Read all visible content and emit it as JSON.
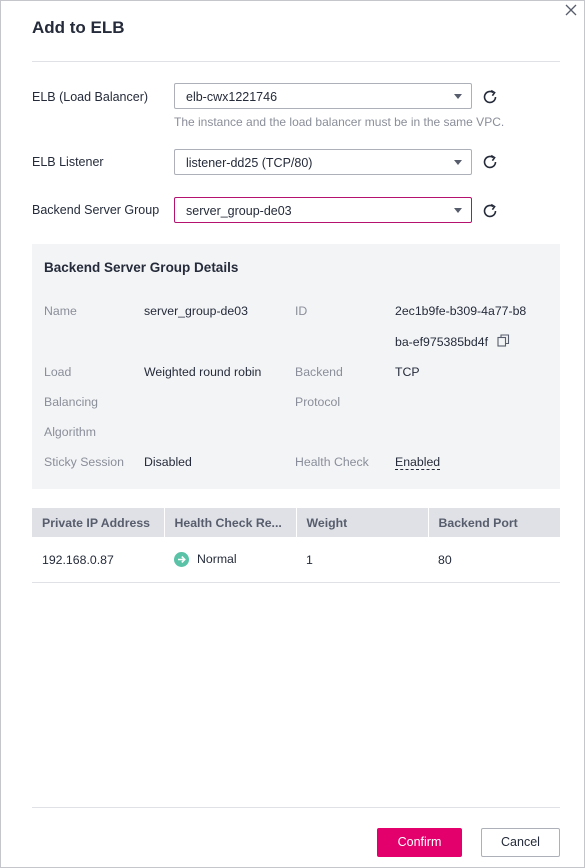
{
  "dialog": {
    "title": "Add to ELB",
    "close_icon": "close-icon"
  },
  "form": {
    "elb_label": "ELB (Load Balancer)",
    "elb_value": "elb-cwx1221746",
    "elb_hint": "The instance and the load balancer must be in the same VPC.",
    "listener_label": "ELB Listener",
    "listener_value": "listener-dd25 (TCP/80)",
    "group_label": "Backend Server Group",
    "group_value": "server_group-de03",
    "refresh_icon": "refresh-icon",
    "dropdown_icon": "chevron-down-icon"
  },
  "details": {
    "title": "Backend Server Group Details",
    "name_label": "Name",
    "name_value": "server_group-de03",
    "id_label": "ID",
    "id_value_line1": "2ec1b9fe-b309-4a77-b8",
    "id_value_line2": "ba-ef975385bd4f",
    "copy_icon": "copy-icon",
    "lb_label_line1": "Load",
    "lb_label_line2": "Balancing",
    "lb_label_line3": "Algorithm",
    "lb_value": "Weighted round robin",
    "proto_label_line1": "Backend",
    "proto_label_line2": "Protocol",
    "proto_value": "TCP",
    "sticky_label": "Sticky Session",
    "sticky_value": "Disabled",
    "health_label": "Health Check",
    "health_value": "Enabled"
  },
  "table": {
    "columns": [
      "Private IP Address",
      "Health Check Re...",
      "Weight",
      "Backend Port"
    ],
    "rows": [
      {
        "ip": "192.168.0.87",
        "health": "Normal",
        "health_icon": "arrow-right-circle-icon",
        "weight": "1",
        "port": "80"
      }
    ]
  },
  "footer": {
    "confirm_label": "Confirm",
    "cancel_label": "Cancel"
  },
  "colors": {
    "accent": "#e3006c",
    "active_border": "#b5116f",
    "status_normal": "#5ac2a6"
  }
}
